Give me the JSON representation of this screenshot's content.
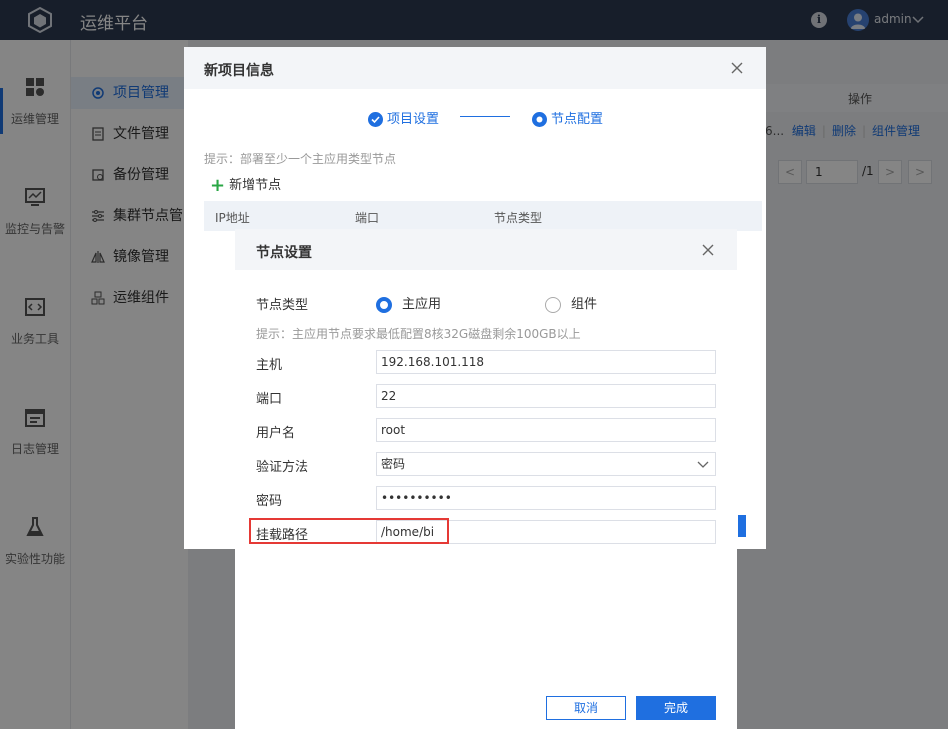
{
  "app": {
    "title": "运维平台",
    "user": "admin"
  },
  "rail": [
    {
      "label": "运维管理",
      "icon": "grid-icon"
    },
    {
      "label": "监控与告警",
      "icon": "monitor-icon"
    },
    {
      "label": "业务工具",
      "icon": "code-icon"
    },
    {
      "label": "日志管理",
      "icon": "calendar-icon"
    },
    {
      "label": "实验性功能",
      "icon": "flask-icon"
    }
  ],
  "subnav": [
    {
      "label": "项目管理",
      "icon": "gear-icon",
      "active": true
    },
    {
      "label": "文件管理",
      "icon": "file-icon"
    },
    {
      "label": "备份管理",
      "icon": "backup-icon"
    },
    {
      "label": "集群节点管",
      "icon": "sliders-icon"
    },
    {
      "label": "镜像管理",
      "icon": "mirror-icon"
    },
    {
      "label": "运维组件",
      "icon": "components-icon"
    }
  ],
  "background": {
    "op_header": "操作",
    "row_ops": {
      "truncated": "6...",
      "edit": "编辑",
      "delete": "删除",
      "components": "组件管理"
    },
    "pager": {
      "prev": "<",
      "page": "1",
      "total": "/1",
      "next": ">"
    }
  },
  "dialog1": {
    "title": "新项目信息",
    "steps": [
      "项目设置",
      "节点配置"
    ],
    "hint": "提示：部署至少一个主应用类型节点",
    "add_node": "新增节点",
    "columns": [
      "IP地址",
      "端口",
      "节点类型"
    ]
  },
  "dialog2": {
    "title": "节点设置",
    "node_type_label": "节点类型",
    "options": [
      "主应用",
      "组件"
    ],
    "selected_option": "主应用",
    "hint": "提示：主应用节点要求最低配置8核32G磁盘剩余100GB以上",
    "host_label": "主机",
    "host_value": "192.168.101.118",
    "port_label": "端口",
    "port_value": "22",
    "user_label": "用户名",
    "user_value": "root",
    "auth_label": "验证方法",
    "auth_value": "密码",
    "password_label": "密码",
    "password_value": "••••••••••",
    "mount_label": "挂载路径",
    "mount_value": "/home/bi",
    "cancel": "取消",
    "finish": "完成"
  },
  "colors": {
    "primary": "#1f6fe0",
    "topbar": "#2d3b52",
    "highlight": "#e53935",
    "add": "#2aa745"
  }
}
